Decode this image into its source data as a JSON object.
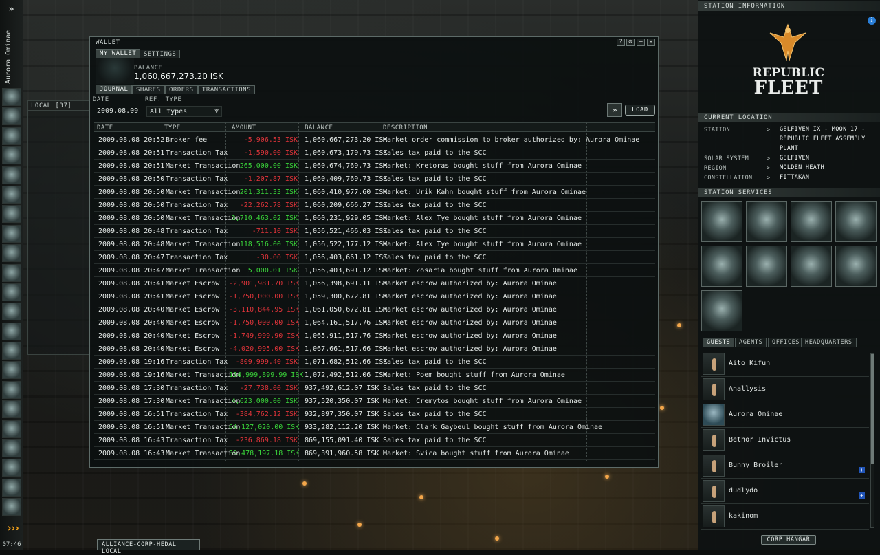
{
  "neocom": {
    "expand_icon": "double-chevron-icon",
    "character_name": "Aurora Ominae",
    "clock": "07:46",
    "buttons": [
      "character-sheet-icon",
      "people-icon",
      "mail-icon",
      "market-icon",
      "assets-icon",
      "industry-icon",
      "journal-icon",
      "map-icon",
      "starmap-icon",
      "cargo-icon",
      "science-icon",
      "contracts-icon",
      "corporation-icon",
      "fitting-icon",
      "wallet-icon",
      "notepad-icon",
      "fleet-icon",
      "scanner-icon",
      "military-icon",
      "help-icon",
      "ship-icon",
      "drones-icon"
    ]
  },
  "local_chat": {
    "header": "LOCAL [37]"
  },
  "chat_tab": "ALLIANCE-CORP-HEDAL LOCAL",
  "wallet": {
    "title": "WALLET",
    "controls": [
      "?",
      "⊙",
      "–",
      "×"
    ],
    "tabs_top": [
      "MY WALLET",
      "SETTINGS"
    ],
    "balance_label": "BALANCE",
    "balance": "1,060,667,273.20 ISK",
    "tabs": [
      "JOURNAL",
      "SHARES",
      "ORDERS",
      "TRANSACTIONS"
    ],
    "date_label": "DATE",
    "date_value": "2009.08.09",
    "reftype_label": "REF. TYPE",
    "reftype_value": "All types",
    "load_label": "LOAD",
    "columns": [
      "DATE",
      "TYPE",
      "AMOUNT",
      "BALANCE",
      "DESCRIPTION"
    ],
    "rows": [
      {
        "date": "2009.08.08 20:52",
        "type": "Broker fee",
        "amount": "-5,906.53 ISK",
        "sign": "neg",
        "balance": "1,060,667,273.20 ISK",
        "desc": "Market order commission to broker authorized by: Aurora Ominae"
      },
      {
        "date": "2009.08.08 20:51",
        "type": "Transaction Tax",
        "amount": "-1,590.00 ISK",
        "sign": "neg",
        "balance": "1,060,673,179.73 ISK",
        "desc": "Sales tax paid to the SCC"
      },
      {
        "date": "2009.08.08 20:51",
        "type": "Market Transaction",
        "amount": "265,000.00 ISK",
        "sign": "pos",
        "balance": "1,060,674,769.73 ISK",
        "desc": "Market: Kretoras bought stuff from Aurora Ominae"
      },
      {
        "date": "2009.08.08 20:50",
        "type": "Transaction Tax",
        "amount": "-1,207.87 ISK",
        "sign": "neg",
        "balance": "1,060,409,769.73 ISK",
        "desc": "Sales tax paid to the SCC"
      },
      {
        "date": "2009.08.08 20:50",
        "type": "Market Transaction",
        "amount": "201,311.33 ISK",
        "sign": "pos",
        "balance": "1,060,410,977.60 ISK",
        "desc": "Market: Urik Kahn bought stuff from Aurora Ominae"
      },
      {
        "date": "2009.08.08 20:50",
        "type": "Transaction Tax",
        "amount": "-22,262.78 ISK",
        "sign": "neg",
        "balance": "1,060,209,666.27 ISK",
        "desc": "Sales tax paid to the SCC"
      },
      {
        "date": "2009.08.08 20:50",
        "type": "Market Transaction",
        "amount": "3,710,463.02 ISK",
        "sign": "pos",
        "balance": "1,060,231,929.05 ISK",
        "desc": "Market: Alex Tye bought stuff from Aurora Ominae"
      },
      {
        "date": "2009.08.08 20:48",
        "type": "Transaction Tax",
        "amount": "-711.10 ISK",
        "sign": "neg",
        "balance": "1,056,521,466.03 ISK",
        "desc": "Sales tax paid to the SCC"
      },
      {
        "date": "2009.08.08 20:48",
        "type": "Market Transaction",
        "amount": "118,516.00 ISK",
        "sign": "pos",
        "balance": "1,056,522,177.12 ISK",
        "desc": "Market: Alex Tye bought stuff from Aurora Ominae"
      },
      {
        "date": "2009.08.08 20:47",
        "type": "Transaction Tax",
        "amount": "-30.00 ISK",
        "sign": "neg",
        "balance": "1,056,403,661.12 ISK",
        "desc": "Sales tax paid to the SCC"
      },
      {
        "date": "2009.08.08 20:47",
        "type": "Market Transaction",
        "amount": "5,000.01 ISK",
        "sign": "pos",
        "balance": "1,056,403,691.12 ISK",
        "desc": "Market: Zosaria bought stuff from Aurora Ominae"
      },
      {
        "date": "2009.08.08 20:41",
        "type": "Market Escrow",
        "amount": "-2,901,981.70 ISK",
        "sign": "neg",
        "balance": "1,056,398,691.11 ISK",
        "desc": "Market escrow authorized by: Aurora Ominae"
      },
      {
        "date": "2009.08.08 20:41",
        "type": "Market Escrow",
        "amount": "-1,750,000.00 ISK",
        "sign": "neg",
        "balance": "1,059,300,672.81 ISK",
        "desc": "Market escrow authorized by: Aurora Ominae"
      },
      {
        "date": "2009.08.08 20:40",
        "type": "Market Escrow",
        "amount": "-3,110,844.95 ISK",
        "sign": "neg",
        "balance": "1,061,050,672.81 ISK",
        "desc": "Market escrow authorized by: Aurora Ominae"
      },
      {
        "date": "2009.08.08 20:40",
        "type": "Market Escrow",
        "amount": "-1,750,000.00 ISK",
        "sign": "neg",
        "balance": "1,064,161,517.76 ISK",
        "desc": "Market escrow authorized by: Aurora Ominae"
      },
      {
        "date": "2009.08.08 20:40",
        "type": "Market Escrow",
        "amount": "-1,749,999.90 ISK",
        "sign": "neg",
        "balance": "1,065,911,517.76 ISK",
        "desc": "Market escrow authorized by: Aurora Ominae"
      },
      {
        "date": "2009.08.08 20:40",
        "type": "Market Escrow",
        "amount": "-4,020,995.00 ISK",
        "sign": "neg",
        "balance": "1,067,661,517.66 ISK",
        "desc": "Market escrow authorized by: Aurora Ominae"
      },
      {
        "date": "2009.08.08 19:16",
        "type": "Transaction Tax",
        "amount": "-809,999.40 ISK",
        "sign": "neg",
        "balance": "1,071,682,512.66 ISK",
        "desc": "Sales tax paid to the SCC"
      },
      {
        "date": "2009.08.08 19:16",
        "type": "Market Transaction",
        "amount": "134,999,899.99 ISK",
        "sign": "pos",
        "balance": "1,072,492,512.06 ISK",
        "desc": "Market: Poem bought stuff from Aurora Ominae"
      },
      {
        "date": "2009.08.08 17:30",
        "type": "Transaction Tax",
        "amount": "-27,738.00 ISK",
        "sign": "neg",
        "balance": "937,492,612.07 ISK",
        "desc": "Sales tax paid to the SCC"
      },
      {
        "date": "2009.08.08 17:30",
        "type": "Market Transaction",
        "amount": "4,623,000.00 ISK",
        "sign": "pos",
        "balance": "937,520,350.07 ISK",
        "desc": "Market: Cremytos bought stuff from Aurora Ominae"
      },
      {
        "date": "2009.08.08 16:51",
        "type": "Transaction Tax",
        "amount": "-384,762.12 ISK",
        "sign": "neg",
        "balance": "932,897,350.07 ISK",
        "desc": "Sales tax paid to the SCC"
      },
      {
        "date": "2009.08.08 16:51",
        "type": "Market Transaction",
        "amount": "64,127,020.00 ISK",
        "sign": "pos",
        "balance": "933,282,112.20 ISK",
        "desc": "Market: Clark Gaybeul bought stuff from Aurora Ominae"
      },
      {
        "date": "2009.08.08 16:43",
        "type": "Transaction Tax",
        "amount": "-236,869.18 ISK",
        "sign": "neg",
        "balance": "869,155,091.40 ISK",
        "desc": "Sales tax paid to the SCC"
      },
      {
        "date": "2009.08.08 16:43",
        "type": "Market Transaction",
        "amount": "39,478,197.18 ISK",
        "sign": "pos",
        "balance": "869,391,960.58 ISK",
        "desc": "Market: Svica bought stuff from Aurora Ominae"
      }
    ]
  },
  "station": {
    "header": "STATION INFORMATION",
    "logo_line1": "REPUBLIC",
    "logo_line2": "FLEET",
    "location_header": "CURRENT LOCATION",
    "location": [
      {
        "label": "STATION",
        "value": "GELFIVEN IX - MOON 17 - REPUBLIC FLEET ASSEMBLY PLANT"
      },
      {
        "label": "SOLAR SYSTEM",
        "value": "GELFIVEN"
      },
      {
        "label": "REGION",
        "value": "MOLDEN HEATH"
      },
      {
        "label": "CONSTELLATION",
        "value": "FITTAKAN"
      }
    ],
    "arrow": ">",
    "services_header": "STATION SERVICES",
    "services": [
      "bounty-office-icon",
      "repair-shop-icon",
      "insurance-icon",
      "cloning-icon",
      "factory-icon",
      "laboratory-icon",
      "lp-store-icon",
      "reprocessing-icon",
      "fitting-service-icon"
    ],
    "guest_tabs": [
      "GUESTS",
      "AGENTS",
      "OFFICES",
      "HEADQUARTERS"
    ],
    "guests": [
      {
        "name": "Aito Kifuh",
        "plus": false,
        "img": false
      },
      {
        "name": "Anallysis",
        "plus": false,
        "img": false
      },
      {
        "name": "Aurora Ominae",
        "plus": false,
        "img": true
      },
      {
        "name": "Bethor Invictus",
        "plus": false,
        "img": false
      },
      {
        "name": "Bunny Broiler",
        "plus": true,
        "img": false
      },
      {
        "name": "dudlydo",
        "plus": true,
        "img": false
      },
      {
        "name": "kakinom",
        "plus": false,
        "img": false
      }
    ],
    "corp_hangar": "CORP HANGAR"
  }
}
